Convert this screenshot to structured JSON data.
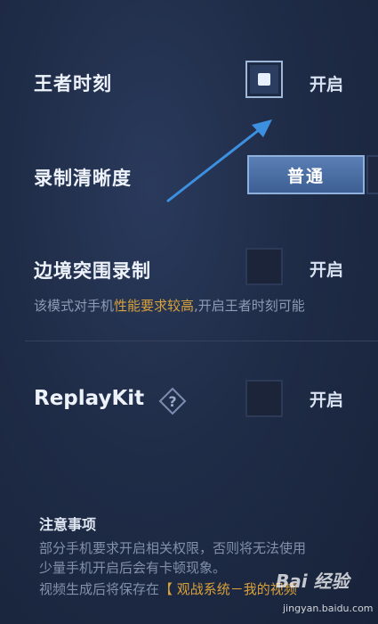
{
  "settings": {
    "glory_moment": {
      "label": "王者时刻",
      "checked": true,
      "option_label": "开启"
    },
    "quality": {
      "label": "录制清晰度",
      "selected": "普通"
    },
    "border_record": {
      "label": "边境突围录制",
      "checked": false,
      "option_label": "开启"
    },
    "border_desc": {
      "prefix": "该模式对手机",
      "highlight": "性能要求较高",
      "suffix": ",开启王者时刻可能"
    },
    "replaykit": {
      "label": "ReplayKit",
      "checked": false,
      "option_label": "开启"
    }
  },
  "notice": {
    "title": "注意事项",
    "line1": "部分手机要求开启相关权限，否则将无法使用",
    "line2": "少量手机开启后会有卡顿现象。",
    "line3_prefix": "视频生成后将保存在",
    "line3_highlight": "【 观战系统－我的视频"
  },
  "watermark": {
    "text": "Bai 经验",
    "sub": "jingyan.baidu.com"
  },
  "colors": {
    "accent": "#d9a13b",
    "button": "#4a6da3",
    "arrow": "#3d8fe0"
  }
}
